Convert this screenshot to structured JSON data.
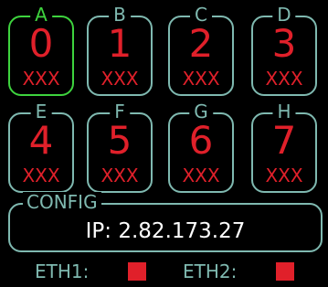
{
  "slots": [
    {
      "letter": "A",
      "number": "0",
      "sub": "XXX",
      "active": true
    },
    {
      "letter": "B",
      "number": "1",
      "sub": "XXX",
      "active": false
    },
    {
      "letter": "C",
      "number": "2",
      "sub": "XXX",
      "active": false
    },
    {
      "letter": "D",
      "number": "3",
      "sub": "XXX",
      "active": false
    },
    {
      "letter": "E",
      "number": "4",
      "sub": "XXX",
      "active": false
    },
    {
      "letter": "F",
      "number": "5",
      "sub": "XXX",
      "active": false
    },
    {
      "letter": "G",
      "number": "6",
      "sub": "XXX",
      "active": false
    },
    {
      "letter": "H",
      "number": "7",
      "sub": "XXX",
      "active": false
    }
  ],
  "config": {
    "title": "CONFIG",
    "ip": "IP: 2.82.173.27"
  },
  "eth": {
    "eth1_label": "ETH1:",
    "eth2_label": "ETH2:",
    "eth1_status": "down",
    "eth2_status": "down"
  },
  "colors": {
    "frame": "#7fb9b0",
    "active": "#3ed33e",
    "value": "#e0202a",
    "ip_text": "#ffffff",
    "led_off": "#e0202a",
    "background": "#000000"
  }
}
